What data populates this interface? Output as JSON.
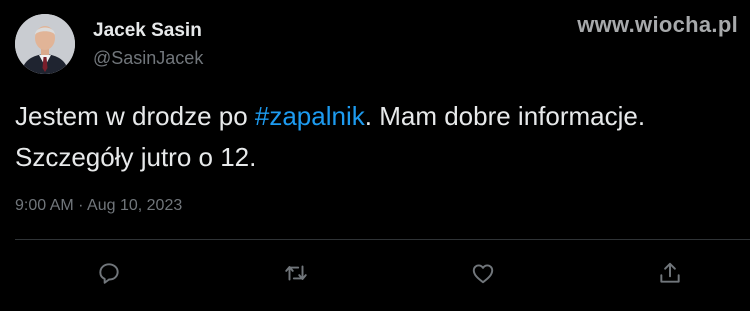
{
  "author": {
    "name": "Jacek Sasin",
    "handle": "@SasinJacek"
  },
  "watermark": "www.wiocha.pl",
  "tweet": {
    "text_before": "Jestem w drodze po ",
    "hashtag": "#zapalnik",
    "text_after": ". Mam dobre informacje.",
    "line2": "Szczegóły jutro o 12.",
    "timestamp": "9:00 AM · Aug 10, 2023"
  },
  "actions": {
    "icons": [
      "reply-icon",
      "retweet-icon",
      "like-icon",
      "share-icon"
    ]
  },
  "colors": {
    "background": "#000000",
    "text": "#e7e9ea",
    "secondary": "#71767b",
    "link": "#1d9bf0",
    "divider": "#2f3336"
  }
}
